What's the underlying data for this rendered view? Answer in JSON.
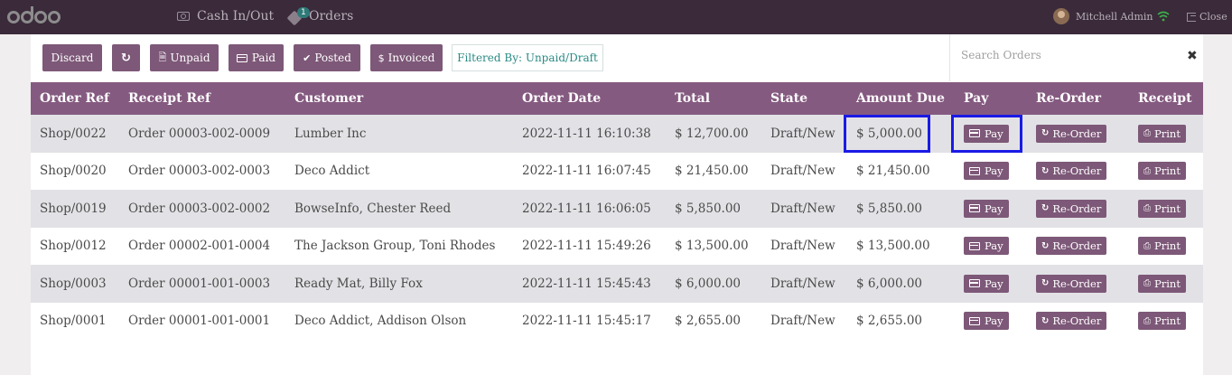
{
  "topbar": {
    "logo_text": "odoo",
    "cash_label": "Cash In/Out",
    "orders_label": "Orders",
    "orders_badge": "1",
    "user_name": "Mitchell Admin",
    "close_label": "Close"
  },
  "toolbar": {
    "discard_label": "Discard",
    "unpaid_label": "Unpaid",
    "paid_label": "Paid",
    "posted_label": "Posted",
    "invoiced_label": "Invoiced",
    "filter_label": "Filtered By: Unpaid/Draft"
  },
  "search": {
    "placeholder": "Search Orders"
  },
  "table": {
    "headers": [
      "Order Ref",
      "Receipt Ref",
      "Customer",
      "Order Date",
      "Total",
      "State",
      "Amount Due",
      "Pay",
      "Re-Order",
      "Receipt"
    ],
    "pay_label": "Pay",
    "reorder_label": "Re-Order",
    "print_label": "Print",
    "rows": [
      {
        "order_ref": "Shop/0022",
        "receipt_ref": "Order 00003-002-0009",
        "customer": "Lumber Inc",
        "date": "2022-11-11 16:10:38",
        "total": "$ 12,700.00",
        "state": "Draft/New",
        "amount_due": "$ 5,000.00"
      },
      {
        "order_ref": "Shop/0020",
        "receipt_ref": "Order 00003-002-0003",
        "customer": "Deco Addict",
        "date": "2022-11-11 16:07:45",
        "total": "$ 21,450.00",
        "state": "Draft/New",
        "amount_due": "$ 21,450.00"
      },
      {
        "order_ref": "Shop/0019",
        "receipt_ref": "Order 00003-002-0002",
        "customer": "BowseInfo, Chester Reed",
        "date": "2022-11-11 16:06:05",
        "total": "$ 5,850.00",
        "state": "Draft/New",
        "amount_due": "$ 5,850.00"
      },
      {
        "order_ref": "Shop/0012",
        "receipt_ref": "Order 00002-001-0004",
        "customer": "The Jackson Group, Toni Rhodes",
        "date": "2022-11-11 15:49:26",
        "total": "$ 13,500.00",
        "state": "Draft/New",
        "amount_due": "$ 13,500.00"
      },
      {
        "order_ref": "Shop/0003",
        "receipt_ref": "Order 00001-001-0003",
        "customer": "Ready Mat, Billy Fox",
        "date": "2022-11-11 15:45:43",
        "total": "$ 6,000.00",
        "state": "Draft/New",
        "amount_due": "$ 6,000.00"
      },
      {
        "order_ref": "Shop/0001",
        "receipt_ref": "Order 00001-001-0001",
        "customer": "Deco Addict, Addison Olson",
        "date": "2022-11-11 15:45:17",
        "total": "$ 2,655.00",
        "state": "Draft/New",
        "amount_due": "$ 2,655.00"
      }
    ]
  },
  "colors": {
    "topbar_bg": "#3a2a3a",
    "accent": "#7d5878",
    "header_bg": "#855a80",
    "highlight_border": "#1a1ae6"
  }
}
